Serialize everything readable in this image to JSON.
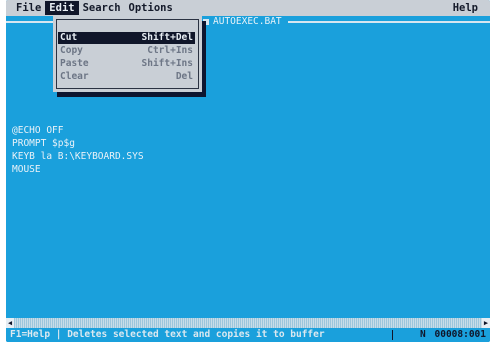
{
  "menubar": {
    "items": [
      "File",
      "Edit",
      "Search",
      "Options"
    ],
    "help": "Help"
  },
  "editor": {
    "filename": "AUTOEXEC.BAT",
    "lines": [
      "@ECHO OFF",
      "PROMPT $p$g",
      "KEYB la B:\\KEYBOARD.SYS",
      "MOUSE"
    ]
  },
  "edit_menu": {
    "items": [
      {
        "label": "Cut",
        "shortcut": "Shift+Del",
        "state": "selected"
      },
      {
        "label": "Copy",
        "shortcut": "Ctrl+Ins",
        "state": "disabled"
      },
      {
        "label": "Paste",
        "shortcut": "Shift+Ins",
        "state": "disabled"
      },
      {
        "label": "Clear",
        "shortcut": "Del",
        "state": "disabled"
      }
    ]
  },
  "statusbar": {
    "message": "F1=Help | Deletes selected text and copies it to buffer",
    "mode": "N",
    "position": "00008:001"
  },
  "colors": {
    "background": "#1aa0dc",
    "menu": "#c9cfd6",
    "highlight": "#10162a"
  }
}
